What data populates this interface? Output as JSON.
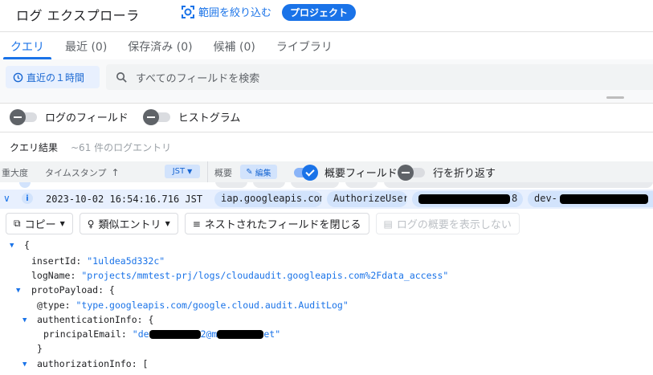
{
  "app": {
    "title": "ログ エクスプローラ",
    "scope_link": "範囲を絞り込む",
    "project_chip": "プロジェクト"
  },
  "tabs": [
    {
      "label": "クエリ",
      "active": true
    },
    {
      "label": "最近 (0)",
      "active": false
    },
    {
      "label": "保存済み (0)",
      "active": false
    },
    {
      "label": "候補 (0)",
      "active": false
    },
    {
      "label": "ライブラリ",
      "active": false
    }
  ],
  "toolbar": {
    "time_range": "直近の１時間",
    "search_placeholder": "すべてのフィールドを検索"
  },
  "toggles": {
    "log_fields": "ログのフィールド",
    "histogram": "ヒストグラム"
  },
  "results": {
    "label": "クエリ結果",
    "count": "~61 件のログエントリ"
  },
  "table_header": {
    "severity": "重大度",
    "timestamp": "タイムスタンプ",
    "timezone": "JST",
    "summary": "概要",
    "edit": "編集",
    "summary_fields": "概要フィールド",
    "wrap_lines": "行を折り返す"
  },
  "entry": {
    "severity_icon": "info-icon",
    "timestamp": "2023-10-02 16:54:16.716 JST",
    "service": "iap.googleapis.com",
    "method": "AuthorizeUser",
    "chip3_suffix": "8",
    "chip4_prefix": "dev-"
  },
  "actions": {
    "copy": "コピー",
    "similar": "類似エントリ",
    "collapse": "ネストされたフィールドを閉じる",
    "hide_summary": "ログの概要を表示しない"
  },
  "json_lines": {
    "open_brace": "{",
    "insert_id_key": "insertId:",
    "insert_id_val": "\"1uldea5d332c\"",
    "log_name_key": "logName:",
    "log_name_val": "\"projects/mmtest-prj/logs/cloudaudit.googleapis.com%2Fdata_access\"",
    "proto_key": "protoPayload: {",
    "type_key": "@type:",
    "type_val": "\"type.googleapis.com/google.cloud.audit.AuditLog\"",
    "auth_key": "authenticationInfo: {",
    "principal_key": "principalEmail:",
    "principal_val_start": "\"de",
    "principal_val_mid": "2@m",
    "principal_val_end": "et\"",
    "close_brace": "}",
    "authz_key": "authorizationInfo: ["
  },
  "colors": {
    "accent": "#1a73e8",
    "chip_bg": "#d2e3fc",
    "row_highlight": "#e8f0fe"
  }
}
